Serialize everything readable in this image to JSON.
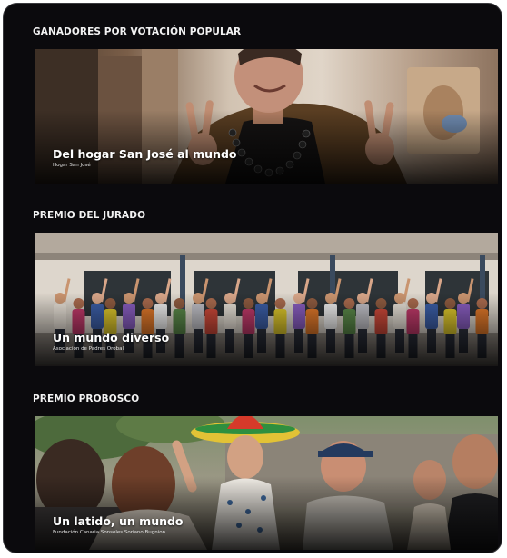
{
  "sections": [
    {
      "title": "GANADORES POR VOTACIÓN POPULAR",
      "card": {
        "title": "Del hogar San José al mundo",
        "subtitle": "Hogar San José"
      }
    },
    {
      "title": "PREMIO DEL JURADO",
      "card": {
        "title": "Un mundo diverso",
        "subtitle": "Asociación de Padres Orobal"
      }
    },
    {
      "title": "PREMIO PROBOSCO",
      "card": {
        "title": "Un latido, un mundo",
        "subtitle": "Fundación Canaria Sonsoles Soriano Bugnion"
      }
    }
  ]
}
